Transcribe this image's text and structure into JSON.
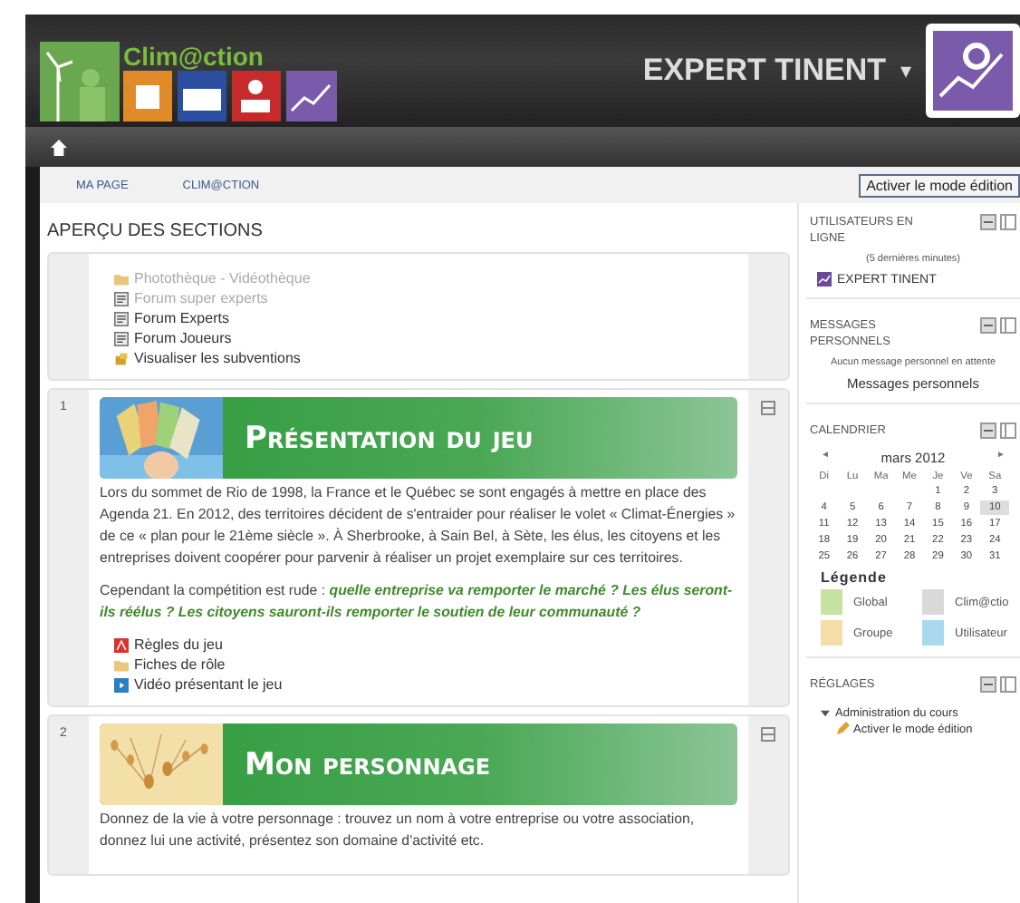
{
  "header": {
    "logo_text": "Clim@ction",
    "user_name": "EXPERT TINENT",
    "user_menu_caret": "▾"
  },
  "breadcrumb": {
    "items": [
      "MA PAGE",
      "CLIM@CTION"
    ],
    "edit_button": "Activer le mode édition"
  },
  "page_title": "APERÇU DES SECTIONS",
  "sections": [
    {
      "activities": [
        {
          "kind": "folder",
          "label": "Photothèque - Vidéothèque",
          "dimmed": true
        },
        {
          "kind": "forum",
          "label": "Forum super experts",
          "dimmed": true
        },
        {
          "kind": "forum",
          "label": "Forum Experts",
          "dimmed": false
        },
        {
          "kind": "forum",
          "label": "Forum Joueurs",
          "dimmed": false
        },
        {
          "kind": "resource",
          "label": "Visualiser les subventions",
          "dimmed": false
        }
      ]
    },
    {
      "number": "1",
      "banner": {
        "title": "Présentation du jeu"
      },
      "paragraphs": [
        "Lors du sommet de Rio de 1998, la France et le Québec se sont engagés à mettre en place des Agenda 21. En 2012, des territoires décident de s'entraider pour réaliser le volet « Climat-Énergies » de ce « plan pour le 21ème siècle ». À Sherbrooke, à Sain Bel, à Sète, les élus, les citoyens et les entreprises doivent coopérer pour parvenir à réaliser un projet exemplaire sur ces territoires.",
        "Cependant la compétition est rude : **quelle entreprise va remporter le marché ? Les élus seront-ils réélus ? Les citoyens sauront-ils remporter le soutien de leur communauté ?**"
      ],
      "activities": [
        {
          "kind": "pdf",
          "label": "Règles du jeu",
          "dimmed": false
        },
        {
          "kind": "folder",
          "label": "Fiches de rôle",
          "dimmed": false
        },
        {
          "kind": "video",
          "label": "Vidéo présentant le jeu",
          "dimmed": false
        }
      ]
    },
    {
      "number": "2",
      "banner": {
        "title": "Mon personnage"
      },
      "paragraphs": [
        "Donnez de la vie à votre personnage : trouvez un nom à votre entreprise ou votre association, donnez lui une activité, présentez son domaine d'activité etc."
      ]
    }
  ],
  "blocks": [
    {
      "kind": "online",
      "title": "UTILISATEURS EN LIGNE",
      "note": "(5 dernières minutes)",
      "user": "EXPERT TINENT"
    },
    {
      "kind": "messages",
      "title": "MESSAGES PERSONNELS",
      "note": "Aucun message personnel en attente",
      "link": "Messages personnels"
    },
    {
      "kind": "calendar",
      "title": "CALENDRIER",
      "prev": "◄",
      "month": "mars 2012",
      "next": "►",
      "weekdays": [
        "Di",
        "Lu",
        "Ma",
        "Me",
        "Je",
        "Ve",
        "Sa"
      ],
      "weeks": [
        [
          {
            "d": "1",
            "selected": false
          },
          {
            "d": "2",
            "selected": false
          },
          {
            "d": "3",
            "selected": false
          }
        ],
        [
          {
            "d": "4",
            "selected": false
          },
          {
            "d": "5",
            "selected": false
          },
          {
            "d": "6",
            "selected": false
          },
          {
            "d": "7",
            "selected": false
          },
          {
            "d": "8",
            "selected": false
          },
          {
            "d": "9",
            "selected": false
          },
          {
            "d": "10",
            "selected": true
          }
        ],
        [
          {
            "d": "11",
            "selected": false
          },
          {
            "d": "12",
            "selected": false
          },
          {
            "d": "13",
            "selected": false
          },
          {
            "d": "14",
            "selected": false
          },
          {
            "d": "15",
            "selected": false
          },
          {
            "d": "16",
            "selected": false
          },
          {
            "d": "17",
            "selected": false
          }
        ],
        [
          {
            "d": "18",
            "selected": false
          },
          {
            "d": "19",
            "selected": false
          },
          {
            "d": "20",
            "selected": false
          },
          {
            "d": "21",
            "selected": false
          },
          {
            "d": "22",
            "selected": false
          },
          {
            "d": "23",
            "selected": false
          },
          {
            "d": "24",
            "selected": false
          }
        ],
        [
          {
            "d": "25",
            "selected": false
          },
          {
            "d": "26",
            "selected": false
          },
          {
            "d": "27",
            "selected": false
          },
          {
            "d": "28",
            "selected": false
          },
          {
            "d": "29",
            "selected": false
          },
          {
            "d": "30",
            "selected": false
          },
          {
            "d": "31",
            "selected": false
          }
        ]
      ],
      "legend_title": "Légende",
      "legend": [
        {
          "label": "Global",
          "color": "#c6e3a4"
        },
        {
          "label": "Clim@ctio",
          "color": "#d9d9d9"
        },
        {
          "label": "Groupe",
          "color": "#f5dca8"
        },
        {
          "label": "Utilisateur",
          "color": "#a9d8ef"
        }
      ]
    },
    {
      "kind": "settings",
      "title": "RÉGLAGES",
      "tree": [
        {
          "label": "Administration du cours",
          "expanded": true,
          "children": [
            {
              "label": "Activer le mode édition"
            }
          ]
        }
      ]
    }
  ]
}
